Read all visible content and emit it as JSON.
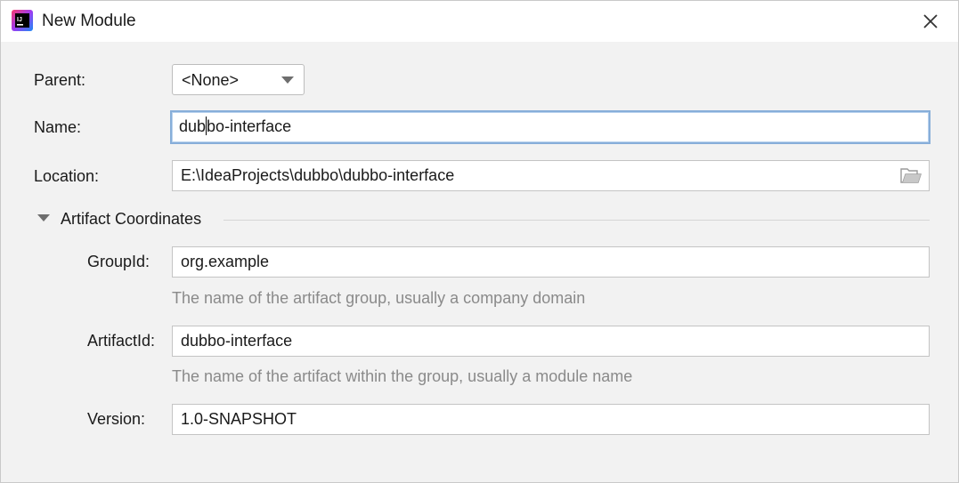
{
  "window": {
    "title": "New Module",
    "app_icon": "intellij-idea-icon",
    "close_icon": "close-icon"
  },
  "form": {
    "parent": {
      "label": "Parent:",
      "value": "<None>"
    },
    "name": {
      "label": "Name:",
      "value_before_caret": "dub",
      "value_after_caret": "bo-interface"
    },
    "location": {
      "label": "Location:",
      "value": "E:\\IdeaProjects\\dubbo\\dubbo-interface",
      "browse_icon": "folder-icon"
    }
  },
  "artifact": {
    "section_title": "Artifact Coordinates",
    "expanded": true,
    "group_id": {
      "label": "GroupId:",
      "value": "org.example",
      "hint": "The name of the artifact group, usually a company domain"
    },
    "artifact_id": {
      "label": "ArtifactId:",
      "value": "dubbo-interface",
      "hint": "The name of the artifact within the group, usually a module name"
    },
    "version": {
      "label": "Version:",
      "value": "1.0-SNAPSHOT"
    }
  },
  "colors": {
    "focus_border": "#87aed9",
    "background": "#f2f2f2",
    "hint_text": "#8a8a8a"
  }
}
